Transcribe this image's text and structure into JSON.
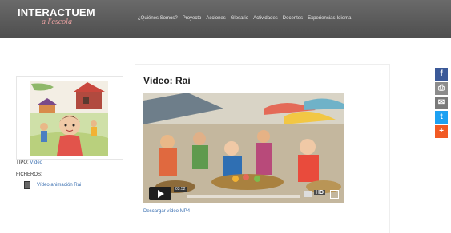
{
  "header": {
    "logo_main": "INTERACTUEM",
    "logo_sub": "a l'escola",
    "nav": [
      "¿Quiénes Somos?",
      "Proyecto",
      "Acciones",
      "Glosario",
      "Actividades",
      "Docentes",
      "Experiencias",
      "Idioma"
    ]
  },
  "sidebar": {
    "tipo_label": "TIPO:",
    "tipo_value": "Vídeo",
    "ficheros_label": "FICHEROS:",
    "file_name": "Vídeo animación Rai"
  },
  "main": {
    "title": "Vídeo: Rai",
    "download_link": "Descargar vídeo MP4"
  },
  "video": {
    "timestamp": "03:52",
    "hd_label": "HD"
  },
  "share": {
    "icons": [
      "facebook-icon",
      "print-icon",
      "email-icon",
      "twitter-icon",
      "plus-icon"
    ],
    "colors": [
      "#3b5998",
      "#8c8c8c",
      "#7a7a7a",
      "#1da1f2",
      "#f15a24"
    ]
  }
}
